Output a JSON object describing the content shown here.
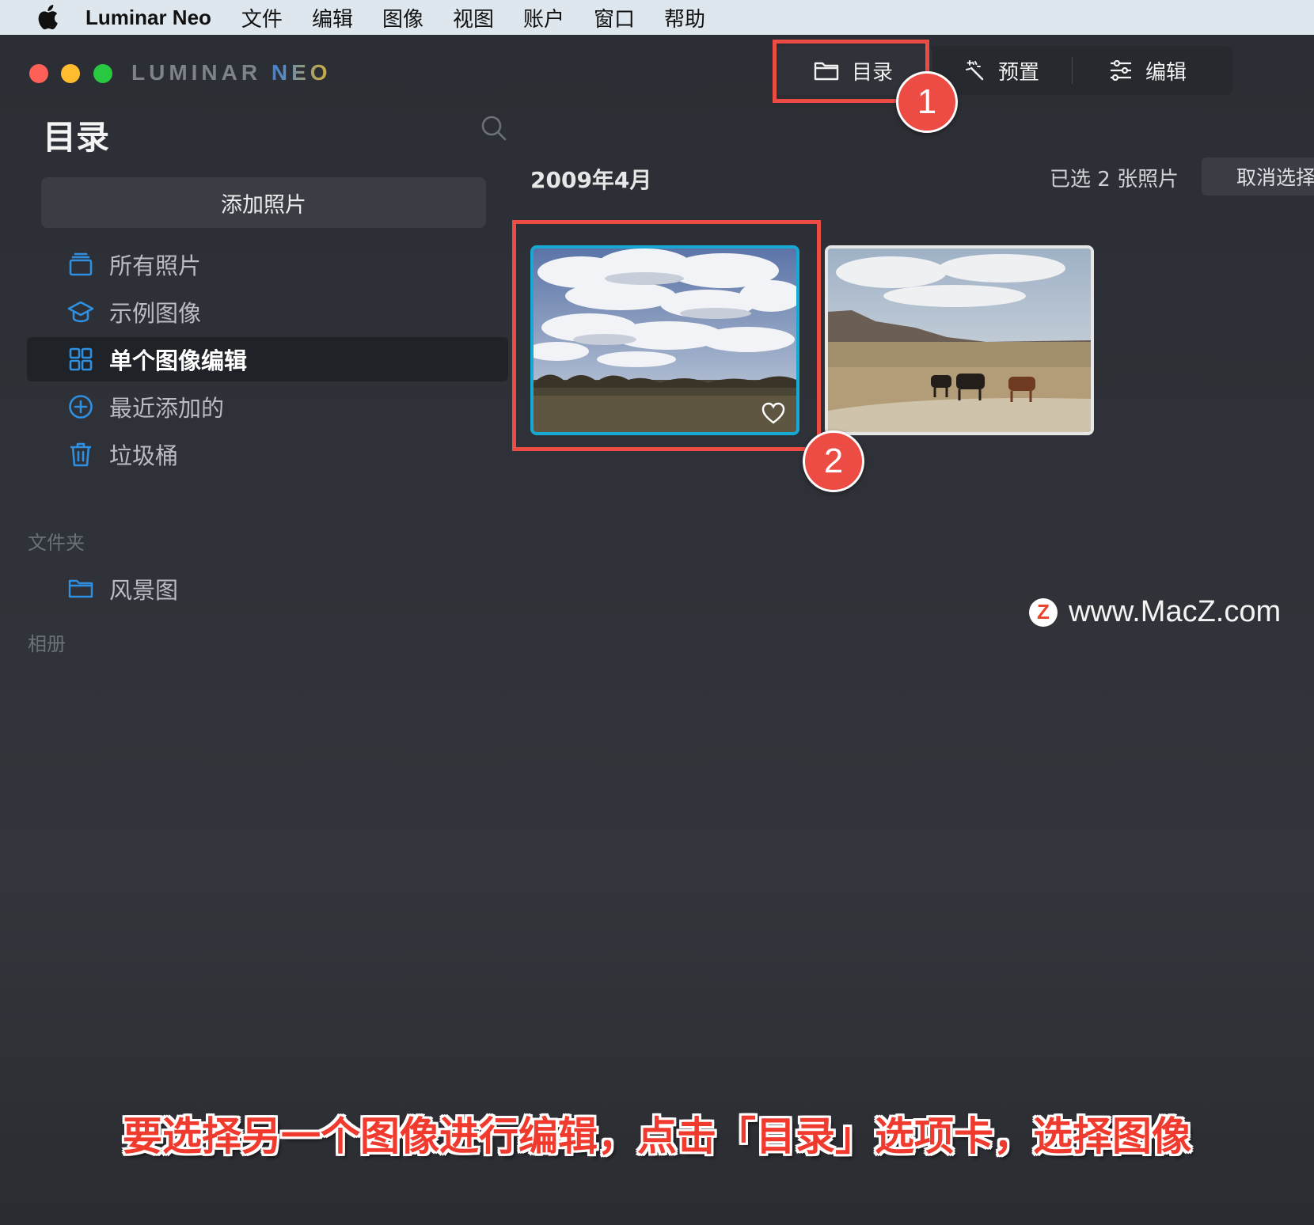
{
  "menubar": {
    "app_name": "Luminar Neo",
    "menus": [
      "文件",
      "编辑",
      "图像",
      "视图",
      "账户",
      "窗口",
      "帮助"
    ]
  },
  "window": {
    "logo_luminar": "LUMINAR",
    "logo_neo": "NEO"
  },
  "tabs": {
    "catalog": "目录",
    "presets": "预置",
    "edit": "编辑"
  },
  "sidebar": {
    "title": "目录",
    "add_photos": "添加照片",
    "items": [
      {
        "label": "所有照片",
        "icon": "photos-stack-icon"
      },
      {
        "label": "示例图像",
        "icon": "graduation-cap-icon"
      },
      {
        "label": "单个图像编辑",
        "icon": "grid-icon",
        "active": true
      },
      {
        "label": "最近添加的",
        "icon": "plus-circle-icon"
      },
      {
        "label": "垃圾桶",
        "icon": "trash-icon"
      }
    ],
    "folders_heading": "文件夹",
    "folders": [
      {
        "label": "风景图",
        "icon": "folder-icon"
      }
    ],
    "albums_heading": "相册"
  },
  "content": {
    "date_heading": "2009年4月",
    "selection_count": "已选 2 张照片",
    "deselect_label": "取消选择"
  },
  "annotations": {
    "badge_1": "1",
    "badge_2": "2",
    "caption": "要选择另一个图像进行编辑，点击「目录」选项卡，选择图像"
  },
  "watermark": {
    "logo": "Z",
    "text": "www.MacZ.com"
  },
  "colors": {
    "accent_selection": "#17a9d4",
    "annotation_red": "#ec4c44",
    "sidebar_icon_blue": "#2f8fe0"
  }
}
